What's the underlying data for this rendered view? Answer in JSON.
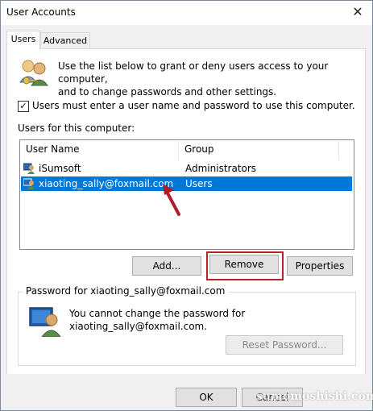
{
  "window": {
    "title": "User Accounts",
    "close_glyph": "✕"
  },
  "tabs": [
    {
      "label": "Users"
    },
    {
      "label": "Advanced"
    }
  ],
  "intro": {
    "line1": "Use the list below to grant or deny users access to your computer,",
    "line2": "and to change passwords and other settings."
  },
  "require_password": {
    "checked": true,
    "label": "Users must enter a user name and password to use this computer."
  },
  "users_list": {
    "label": "Users for this computer:",
    "columns": [
      "User Name",
      "Group"
    ],
    "rows": [
      {
        "name": "iSumsoft",
        "group": "Administrators",
        "selected": false
      },
      {
        "name": "xiaoting_sally@foxmail.com",
        "group": "Users",
        "selected": true
      }
    ]
  },
  "buttons": {
    "add": "Add...",
    "remove": "Remove",
    "properties": "Properties"
  },
  "password_group": {
    "label": "Password for xiaoting_sally@foxmail.com",
    "line1": "You cannot change the password for",
    "line2": "xiaoting_sally@foxmail.com.",
    "reset_button": "Reset Password..."
  },
  "footer": {
    "ok": "OK",
    "cancel": "Cancel"
  },
  "watermark": "sumomoshishi.com",
  "colors": {
    "selection": "#0078d7",
    "highlight_border": "#b8222b",
    "arrow": "#b11c2c"
  }
}
